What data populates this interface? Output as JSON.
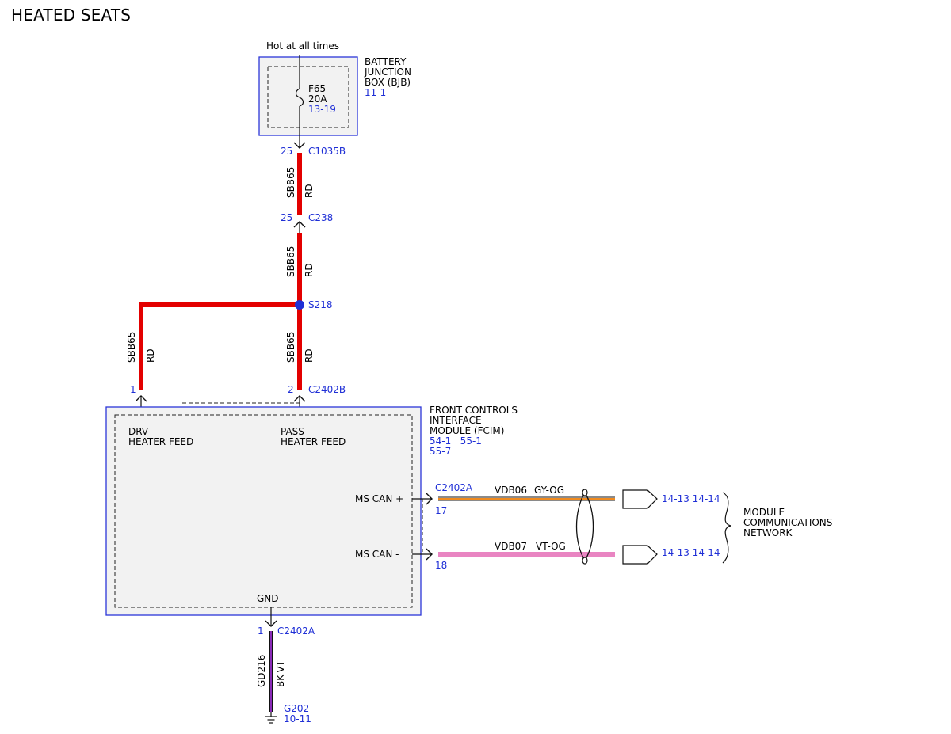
{
  "title": "HEATED SEATS",
  "power_note": "Hot at all times",
  "bjb": {
    "name_lines": [
      "BATTERY",
      "JUNCTION",
      "BOX (BJB)"
    ],
    "ref": "11-1",
    "fuse_id": "F65",
    "fuse_rating": "20A",
    "fuse_ref": "13-19"
  },
  "connectors": {
    "c1035b": {
      "pin": "25",
      "id": "C1035B"
    },
    "c238": {
      "pin": "25",
      "id": "C238"
    },
    "c2402b_drv": {
      "pin": "1"
    },
    "c2402b_pass": {
      "pin": "2",
      "id": "C2402B"
    },
    "c2402a_can": {
      "id": "C2402A",
      "pin_plus": "17",
      "pin_minus": "18"
    },
    "c2402a_gnd": {
      "pin": "1",
      "id": "C2402A"
    }
  },
  "splice": {
    "id": "S218"
  },
  "wires": {
    "feed_1": {
      "circuit": "SBB65",
      "color": "RD"
    },
    "feed_2": {
      "circuit": "SBB65",
      "color": "RD"
    },
    "drv": {
      "circuit": "SBB65",
      "color": "RD"
    },
    "pass": {
      "circuit": "SBB65",
      "color": "RD"
    },
    "can_plus": {
      "circuit": "VDB06",
      "color": "GY-OG"
    },
    "can_minus": {
      "circuit": "VDB07",
      "color": "VT-OG"
    },
    "ground": {
      "circuit": "GD216",
      "color": "BK-VT"
    }
  },
  "fcim": {
    "name_lines": [
      "FRONT CONTROLS",
      "INTERFACE",
      "MODULE (FCIM)"
    ],
    "refs_line1": "54-1   55-1",
    "refs_line2": "55-7",
    "drv_label": [
      "DRV",
      "HEATER FEED"
    ],
    "pass_label": [
      "PASS",
      "HEATER FEED"
    ],
    "can_plus_label": "MS CAN +",
    "can_minus_label": "MS CAN -",
    "gnd_label": "GND"
  },
  "network": {
    "refs_plus": "14-13 14-14",
    "refs_minus": "14-13 14-14",
    "name_lines": [
      "MODULE",
      "COMMUNICATIONS",
      "NETWORK"
    ]
  },
  "ground_point": {
    "id": "G202",
    "ref": "10-11"
  },
  "colors": {
    "outline_blue": "#2b35d8",
    "label_blue": "#1f2fd6",
    "wire_red": "#e30000",
    "wire_gy_og_base": "#8a8a8a",
    "wire_gy_og_stripe": "#f08a1e",
    "wire_vt_og": "#e985c2",
    "wire_bk_vt_base": "#111111",
    "wire_bk_vt_stripe": "#8a2bb8",
    "module_fill": "#f2f2f2"
  }
}
